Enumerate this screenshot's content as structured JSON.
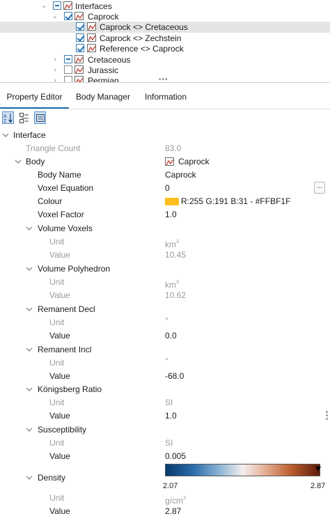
{
  "tree": {
    "items": [
      {
        "label": "Interfaces"
      },
      {
        "label": "Caprock"
      },
      {
        "label": "Caprock <> Cretaceous"
      },
      {
        "label": "Caprock <> Zechstein"
      },
      {
        "label": "Reference <> Caprock"
      },
      {
        "label": "Cretaceous"
      },
      {
        "label": "Jurassic"
      },
      {
        "label": "Permian"
      }
    ]
  },
  "tabs": [
    "Property Editor",
    "Body Manager",
    "Information"
  ],
  "colors": {
    "accent": "#1f6fb5",
    "selection": "#e5e5e5",
    "caprock_colour": "#FFBF1F"
  },
  "properties": {
    "interface": "Interface",
    "triangle_count": {
      "name": "Triangle Count",
      "value": "83.0"
    },
    "body": {
      "name": "Body",
      "value": "Caprock"
    },
    "body_name": {
      "name": "Body Name",
      "value": "Caprock"
    },
    "voxel_equation": {
      "name": "Voxel Equation",
      "value": "0",
      "button": "..."
    },
    "colour": {
      "name": "Colour",
      "value": "R:255 G:191 B:31 - #FFBF1F"
    },
    "voxel_factor": {
      "name": "Voxel Factor",
      "value": "1.0"
    },
    "volume_voxels": {
      "name": "Volume Voxels",
      "unit_label": "Unit",
      "unit": "km",
      "unit_exp": "3",
      "value_label": "Value",
      "value": "10.45"
    },
    "volume_polyhedron": {
      "name": "Volume Polyhedron",
      "unit_label": "Unit",
      "unit": "km",
      "unit_exp": "3",
      "value_label": "Value",
      "value": "10.62"
    },
    "remanent_decl": {
      "name": "Remanent Decl",
      "unit_label": "Unit",
      "unit": "°",
      "value_label": "Value",
      "value": "0.0"
    },
    "remanent_incl": {
      "name": "Remanent Incl",
      "unit_label": "Unit",
      "unit": "°",
      "value_label": "Value",
      "value": "-68.0"
    },
    "konigsberg_ratio": {
      "name": "Königsberg Ratio",
      "unit_label": "Unit",
      "unit": "SI",
      "value_label": "Value",
      "value": "1.0"
    },
    "susceptibility": {
      "name": "Susceptibility",
      "unit_label": "Unit",
      "unit": "SI",
      "value_label": "Value",
      "value": "0.005"
    },
    "density": {
      "name": "Density",
      "colorbar_min": "2.07",
      "colorbar_max": "2.87",
      "unit_label": "Unit",
      "unit": "g/cm",
      "unit_exp": "3",
      "value_label": "Value",
      "value": "2.87"
    }
  }
}
